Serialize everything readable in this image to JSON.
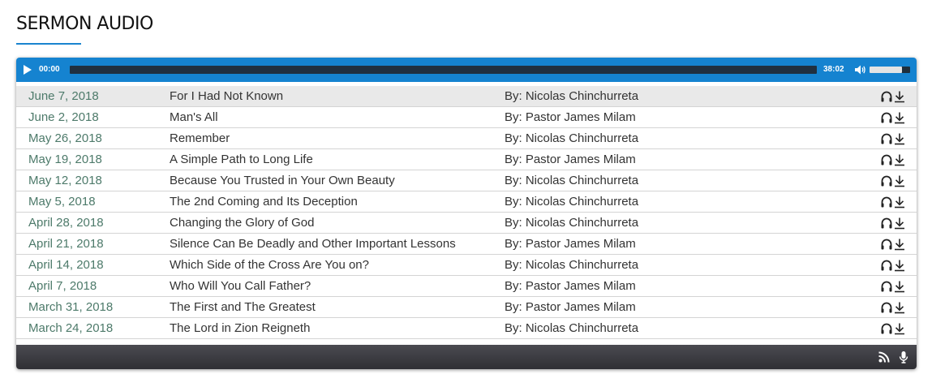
{
  "section": {
    "title": "SERMON AUDIO",
    "accent_color": "#1a84cf"
  },
  "player": {
    "current_time": "00:00",
    "duration": "38:02",
    "progress_fraction": 0.0,
    "volume_fraction": 0.8,
    "bar_color": "#1583d0",
    "play_icon": "play-icon",
    "volume_icon": "volume-icon"
  },
  "sermons": [
    {
      "date": "June 7, 2018",
      "title": "For I Had Not Known",
      "author": "By: Nicolas Chinchurreta"
    },
    {
      "date": "June 2, 2018",
      "title": "Man's All",
      "author": "By: Pastor James Milam"
    },
    {
      "date": "May 26, 2018",
      "title": "Remember",
      "author": "By: Nicolas Chinchurreta"
    },
    {
      "date": "May 19, 2018",
      "title": "A Simple Path to Long Life",
      "author": "By: Pastor James Milam"
    },
    {
      "date": "May 12, 2018",
      "title": "Because You Trusted in Your Own Beauty",
      "author": "By: Nicolas Chinchurreta"
    },
    {
      "date": "May 5, 2018",
      "title": "The 2nd Coming and Its Deception",
      "author": "By: Nicolas Chinchurreta"
    },
    {
      "date": "April 28, 2018",
      "title": "Changing the Glory of God",
      "author": "By: Nicolas Chinchurreta"
    },
    {
      "date": "April 21, 2018",
      "title": "Silence Can Be Deadly and Other Important Lessons",
      "author": "By: Pastor James Milam"
    },
    {
      "date": "April 14, 2018",
      "title": "Which Side of the Cross Are You on?",
      "author": "By: Nicolas Chinchurreta"
    },
    {
      "date": "April 7, 2018",
      "title": "Who Will You Call Father?",
      "author": "By: Pastor James Milam"
    },
    {
      "date": "March 31, 2018",
      "title": "The First and The Greatest",
      "author": "By: Pastor James Milam"
    },
    {
      "date": "March 24, 2018",
      "title": "The Lord in Zion Reigneth",
      "author": "By: Nicolas Chinchurreta"
    }
  ],
  "row_icons": [
    "headphones-icon",
    "download-icon"
  ],
  "active_index": 0,
  "footer": {
    "icons": [
      "rss-icon",
      "microphone-icon"
    ],
    "bar_color": "#3a3a40"
  },
  "colors": {
    "date_text": "#4d7a6a",
    "body_text": "#333333",
    "active_row_bg": "#e9e9e9"
  }
}
